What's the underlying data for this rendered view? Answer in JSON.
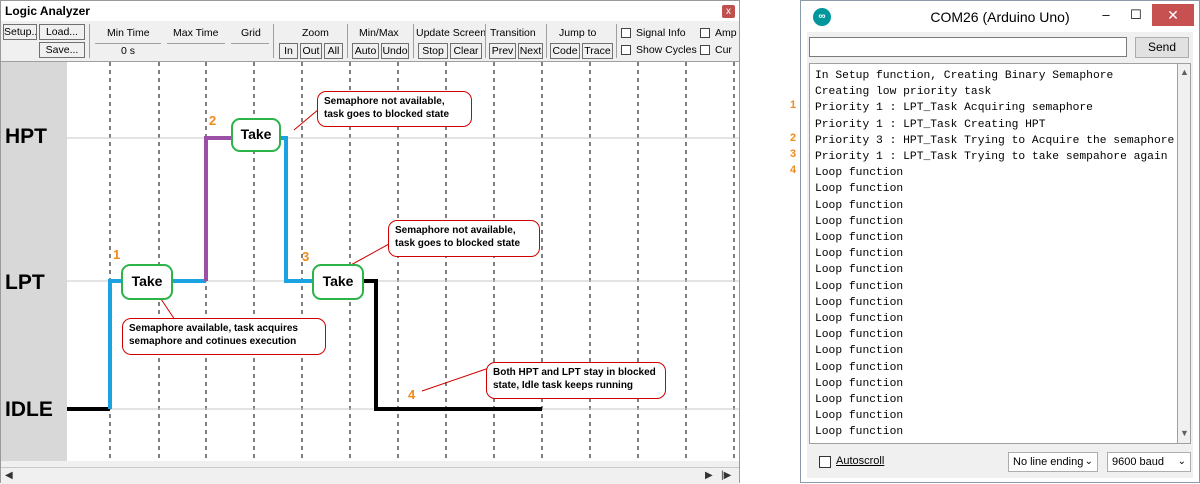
{
  "logic_analyzer": {
    "title": "Logic Analyzer",
    "close_label": "x",
    "buttons": {
      "setup": "Setup...",
      "load": "Load...",
      "save": "Save...",
      "zoom_in": "In",
      "zoom_out": "Out",
      "zoom_all": "All",
      "auto": "Auto",
      "undo": "Undo",
      "stop": "Stop",
      "clear": "Clear",
      "prev": "Prev",
      "next": "Next",
      "code": "Code",
      "trace": "Trace"
    },
    "labels": {
      "min_time": "Min Time",
      "max_time": "Max Time",
      "grid": "Grid",
      "zoom": "Zoom",
      "min_max": "Min/Max",
      "update_screen": "Update Screen",
      "transition": "Transition",
      "jump_to": "Jump to",
      "signal_info": "Signal Info",
      "show_cycles": "Show Cycles",
      "amp": "Amp",
      "cur": "Cur"
    },
    "values": {
      "min_time": "0 s"
    },
    "signals": [
      "HPT",
      "LPT",
      "IDLE"
    ],
    "annotations": {
      "take": "Take",
      "num1": "1",
      "num2": "2",
      "num3": "3",
      "num4": "4",
      "note_hpt_blocked": "Semaphore not available, task goes to blocked state",
      "note_lpt_blocked": "Semaphore not available, task goes to blocked state",
      "note_acquire": "Semaphore available, task acquires semaphore and  cotinues execution",
      "note_idle": "Both HPT and LPT stay in blocked state, Idle task keeps running"
    },
    "colors": {
      "idle": "#000000",
      "lpt": "#1aa3e0",
      "hpt": "#9b4fa5",
      "take_border": "#2cb34a",
      "note_border": "#d00000",
      "marker": "#f08a1c"
    }
  },
  "serial_monitor": {
    "title": "COM26 (Arduino Uno)",
    "send_label": "Send",
    "autoscroll_label": "Autoscroll",
    "line_ending": "No line ending",
    "baud": "9600 baud",
    "lines": [
      "In Setup function, Creating Binary Semaphore",
      "Creating low priority task",
      "Priority 1 : LPT_Task Acquiring semaphore",
      "Priority 1 : LPT_Task Creating HPT",
      "Priority 3 : HPT_Task Trying to Acquire the semaphore",
      "Priority 1 : LPT_Task Trying to take sempahore again",
      "Loop function",
      "Loop function",
      "Loop function",
      "Loop function",
      "Loop function",
      "Loop function",
      "Loop function",
      "Loop function",
      "Loop function",
      "Loop function",
      "Loop function",
      "Loop function",
      "Loop function",
      "Loop function",
      "Loop function",
      "Loop function",
      "Loop function",
      "Loop function",
      "Loop function"
    ],
    "markers": {
      "m1": "1",
      "m2": "2",
      "m3": "3",
      "m4": "4"
    }
  }
}
